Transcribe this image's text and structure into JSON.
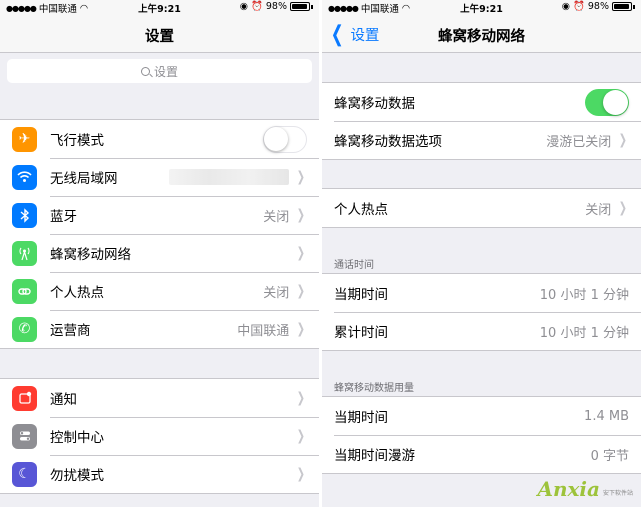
{
  "status_bar": {
    "carrier": "中国联通",
    "time": "上午9:21",
    "battery": "98%"
  },
  "left": {
    "title": "设置",
    "search_placeholder": "设置",
    "group1": [
      {
        "label": "飞行模式",
        "icon": "airplane-icon",
        "color": "#ff9500",
        "control": "toggle-off"
      },
      {
        "label": "无线局域网",
        "icon": "wifi-icon",
        "color": "#007aff",
        "control": "chevron"
      },
      {
        "label": "蓝牙",
        "icon": "bluetooth-icon",
        "color": "#007aff",
        "value": "关闭"
      },
      {
        "label": "蜂窝移动网络",
        "icon": "cellular-icon",
        "color": "#4cd964",
        "control": "chevron"
      },
      {
        "label": "个人热点",
        "icon": "hotspot-icon",
        "color": "#4cd964",
        "value": "关闭"
      },
      {
        "label": "运营商",
        "icon": "phone-icon",
        "color": "#4cd964",
        "value": "中国联通"
      }
    ],
    "group2": [
      {
        "label": "通知",
        "icon": "notifications-icon",
        "color": "#ff3b30"
      },
      {
        "label": "控制中心",
        "icon": "control-center-icon",
        "color": "#8e8e93"
      },
      {
        "label": "勿扰模式",
        "icon": "moon-icon",
        "color": "#5856d6"
      }
    ]
  },
  "right": {
    "back_label": "设置",
    "title": "蜂窝移动网络",
    "group1": [
      {
        "label": "蜂窝移动数据",
        "control": "toggle-on"
      },
      {
        "label": "蜂窝移动数据选项",
        "value": "漫游已关闭"
      }
    ],
    "group2": [
      {
        "label": "个人热点",
        "value": "关闭"
      }
    ],
    "call_time_header": "通话时间",
    "call_time": [
      {
        "label": "当期时间",
        "value": "10 小时 1 分钟"
      },
      {
        "label": "累计时间",
        "value": "10 小时 1 分钟"
      }
    ],
    "data_usage_header": "蜂窝移动数据用量",
    "data_usage": [
      {
        "label": "当期时间",
        "value": "1.4 MB"
      },
      {
        "label": "当期时间漫游",
        "value": "0 字节"
      }
    ]
  },
  "watermark": {
    "text": "Anxia",
    "sub": "安下软件站"
  }
}
